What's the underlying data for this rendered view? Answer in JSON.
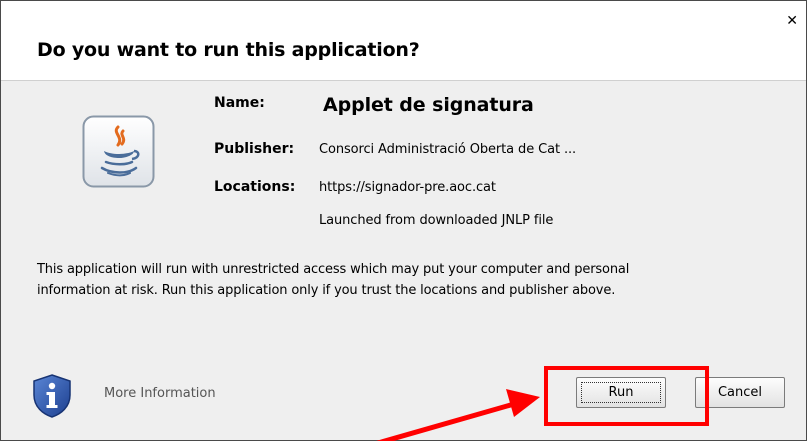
{
  "dialog": {
    "title": "Do you want to run this application?",
    "close_icon": "close-icon"
  },
  "app": {
    "icon": "java-icon",
    "name_label": "Name:",
    "name": "Applet de signatura",
    "publisher_label": "Publisher:",
    "publisher": "Consorci Administració Oberta de Cat ...",
    "locations_label": "Locations:",
    "location": "https://signador-pre.aoc.cat",
    "launched_from": "Launched from downloaded JNLP file"
  },
  "warning": {
    "line1": "This application will run with unrestricted access which may put your computer and personal",
    "line2": "information at risk. Run this application only if you trust the locations and publisher above."
  },
  "footer": {
    "info_icon": "info-shield-icon",
    "more_info": "More Information",
    "run_label": "Run",
    "cancel_label": "Cancel"
  },
  "annotation": {
    "highlight_color": "#ff0000"
  }
}
